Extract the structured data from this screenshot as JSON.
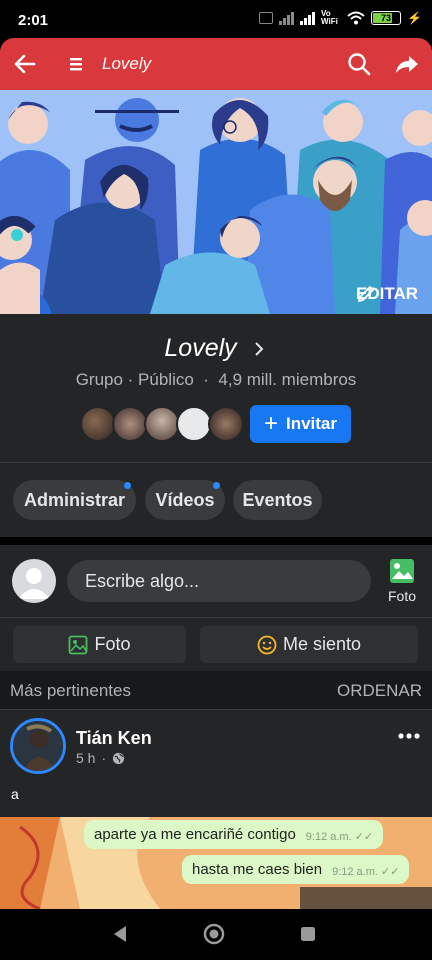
{
  "status_bar": {
    "time": "2:01",
    "network_label": "Vo WiFi",
    "battery_percent": "73",
    "battery_level": 0.73
  },
  "app_bar": {
    "title": "Lovely"
  },
  "cover": {
    "edit_label": "EDITAR"
  },
  "group": {
    "name": "Lovely",
    "privacy": "Grupo · Público",
    "members": "4,9 mill. miembros",
    "invite_label": "Invitar"
  },
  "chips": [
    {
      "label": "Administrar",
      "has_badge": true
    },
    {
      "label": "Vídeos",
      "has_badge": true
    },
    {
      "label": "Eventos",
      "has_badge": false
    }
  ],
  "composer": {
    "placeholder": "Escribe algo...",
    "photo_label": "Foto"
  },
  "actions": {
    "photo_label": "Foto",
    "feeling_label": "Me siento"
  },
  "feed": {
    "sort_left": "Más pertinentes",
    "sort_right": "ORDENAR"
  },
  "post": {
    "author": "Tián Ken",
    "time": "5 h",
    "text": "a",
    "image_messages": [
      {
        "text": "aparte ya me encariñé contigo",
        "time": "9:12 a.m. ✓✓"
      },
      {
        "text": "hasta me caes bien",
        "time": "9:12 a.m. ✓✓"
      }
    ]
  },
  "colors": {
    "app_bar": "#d9393d",
    "accent": "#1877f2",
    "surface": "#242526",
    "cover": "#8fb8f5"
  }
}
